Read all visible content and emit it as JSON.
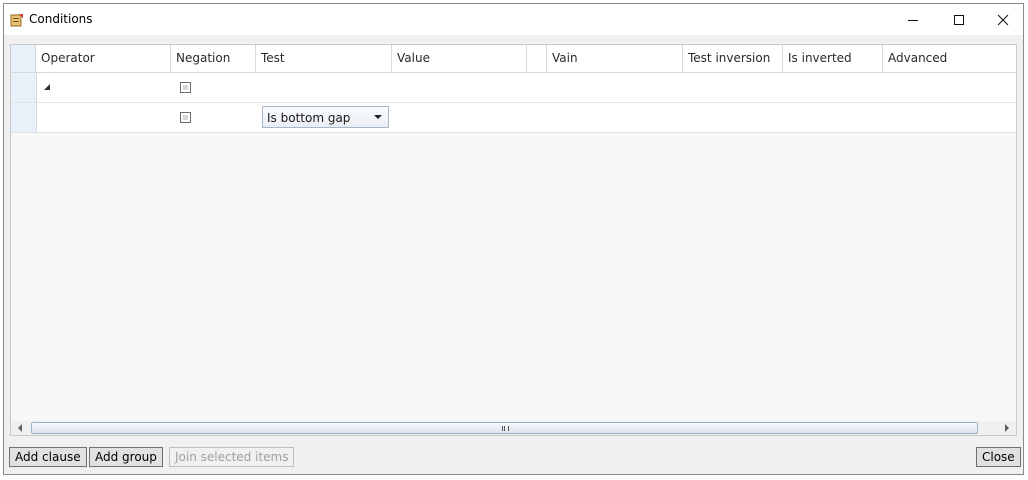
{
  "window": {
    "title": "Conditions",
    "minimize_symbol": "—",
    "maximize_symbol": "☐",
    "close_symbol": "✕",
    "icon": "conditions-app-icon"
  },
  "grid": {
    "columns": [
      "Operator",
      "Negation",
      "Test",
      "Value",
      "",
      "Vain",
      "Test inversion",
      "Is inverted",
      "Advanced"
    ],
    "rows": [
      {
        "operator": "",
        "negation_checked": false,
        "expanded": true
      },
      {
        "operator": "",
        "negation_checked": false,
        "test": "Is bottom gap"
      }
    ]
  },
  "buttons": {
    "add_clause": "Add clause",
    "add_group": "Add group",
    "join_selected": "Join selected items",
    "close": "Close"
  }
}
